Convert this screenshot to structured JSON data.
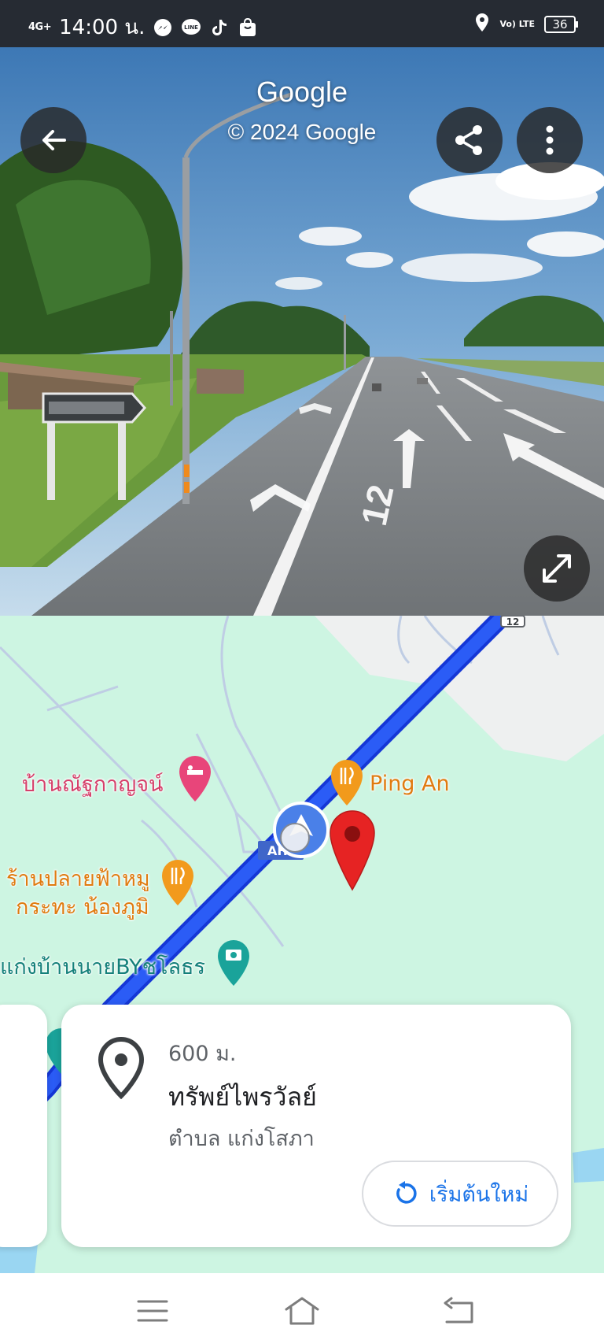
{
  "status_bar": {
    "network": "4G+",
    "time": "14:00 น.",
    "battery": "36",
    "volte": "Vo) LTE",
    "icons": [
      "messenger-icon",
      "line-icon",
      "tiktok-icon",
      "shopee-icon",
      "location-icon",
      "volte-icon",
      "battery-icon"
    ]
  },
  "street_view": {
    "brand": "Google",
    "copyright": "© 2024 Google",
    "road_number": "12",
    "buttons": [
      "back-arrow-icon",
      "share-icon",
      "more-vert-icon",
      "fullscreen-icon"
    ]
  },
  "map": {
    "route_shield": "12",
    "route_label": "AH",
    "pois": [
      {
        "name": "บ้านณัฐกาญจน์",
        "type": "lodging",
        "color": "#e8457a"
      },
      {
        "name": "Ping An",
        "type": "restaurant",
        "color": "#f29a1c"
      },
      {
        "name_line1": "ร้านปลายฟ้าหมู",
        "name_line2": "กระทะ น้องภูมิ",
        "type": "restaurant",
        "color": "#f29a1c"
      },
      {
        "name": "แก่งบ้านนายBYชโลธร",
        "type": "photo-spot",
        "color": "#1aa39a"
      }
    ],
    "route_color": "#1a4bf0",
    "pin_color": "#e62323"
  },
  "place_card": {
    "distance": "600 ม.",
    "name": "ทรัพย์ไพรวัลย์",
    "subtitle": "ตำบล แก่งโสภา",
    "restart_label": "เริ่มต้นใหม่",
    "accent": "#1a73e8"
  },
  "nav_bar": {
    "buttons": [
      "menu-icon",
      "home-icon",
      "back-icon"
    ]
  }
}
